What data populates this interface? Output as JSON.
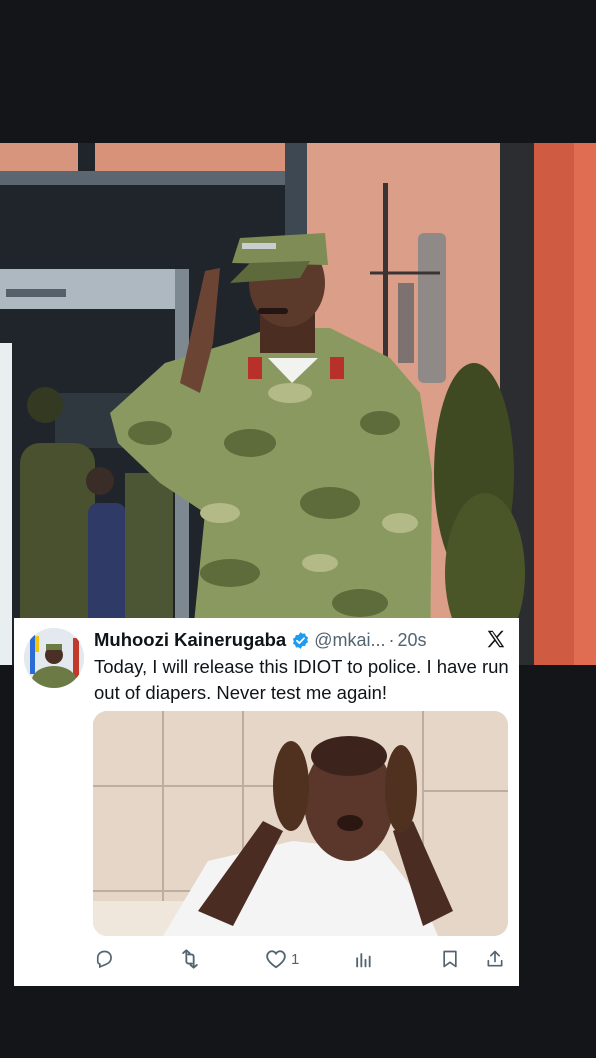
{
  "tweet": {
    "display_name": "Muhoozi Kainerugaba",
    "handle": "@mkai...",
    "separator": "·",
    "time": "20s",
    "text": "Today, I will release this IDIOT to police. I have run out of diapers. Never test me again!",
    "verified": true
  },
  "actions": {
    "reply_icon": "reply-icon",
    "retweet_icon": "retweet-icon",
    "like_icon": "heart-icon",
    "like_count": "1",
    "views_icon": "analytics-icon",
    "bookmark_icon": "bookmark-icon",
    "share_icon": "share-icon"
  },
  "colors": {
    "background": "#141519",
    "verified_badge": "#1d9bf0",
    "secondary_text": "#536471",
    "primary_text": "#0f1419"
  }
}
